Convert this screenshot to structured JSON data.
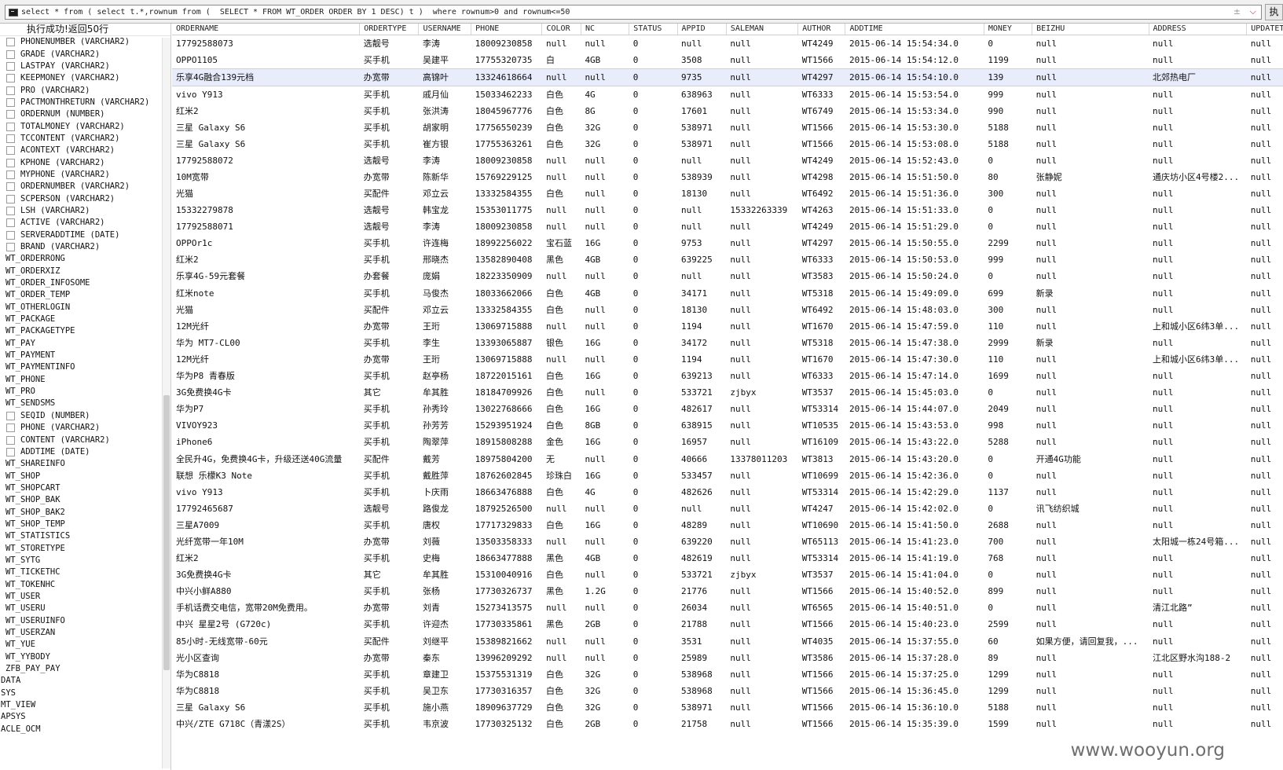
{
  "query": {
    "sql": "select * from ( select t.*,rownum from (  SELECT * FROM WT_ORDER ORDER BY 1 DESC) t )  where rownum>0 and rownum<=50",
    "exec_label": "执"
  },
  "status_text": "执行成功!返回50行",
  "tree": [
    {
      "label": "PHONENUMBER (VARCHAR2)",
      "kind": "col"
    },
    {
      "label": "GRADE (VARCHAR2)",
      "kind": "col"
    },
    {
      "label": "LASTPAY (VARCHAR2)",
      "kind": "col"
    },
    {
      "label": "KEEPMONEY (VARCHAR2)",
      "kind": "col"
    },
    {
      "label": "PRO (VARCHAR2)",
      "kind": "col"
    },
    {
      "label": "PACTMONTHRETURN (VARCHAR2)",
      "kind": "col"
    },
    {
      "label": "ORDERNUM (NUMBER)",
      "kind": "col"
    },
    {
      "label": "TOTALMONEY (VARCHAR2)",
      "kind": "col"
    },
    {
      "label": "TCCONTENT (VARCHAR2)",
      "kind": "col"
    },
    {
      "label": "ACONTEXT (VARCHAR2)",
      "kind": "col"
    },
    {
      "label": "KPHONE (VARCHAR2)",
      "kind": "col"
    },
    {
      "label": "MYPHONE (VARCHAR2)",
      "kind": "col"
    },
    {
      "label": "ORDERNUMBER (VARCHAR2)",
      "kind": "col"
    },
    {
      "label": "SCPERSON (VARCHAR2)",
      "kind": "col"
    },
    {
      "label": "LSH (VARCHAR2)",
      "kind": "col"
    },
    {
      "label": "ACTIVE (VARCHAR2)",
      "kind": "col"
    },
    {
      "label": "SERVERADDTIME (DATE)",
      "kind": "col"
    },
    {
      "label": "BRAND (VARCHAR2)",
      "kind": "col"
    },
    {
      "label": "WT_ORDERRONG",
      "kind": "tbl"
    },
    {
      "label": "WT_ORDERXIZ",
      "kind": "tbl"
    },
    {
      "label": "WT_ORDER_INFOSOME",
      "kind": "tbl"
    },
    {
      "label": "WT_ORDER_TEMP",
      "kind": "tbl"
    },
    {
      "label": "WT_OTHERLOGIN",
      "kind": "tbl"
    },
    {
      "label": "WT_PACKAGE",
      "kind": "tbl"
    },
    {
      "label": "WT_PACKAGETYPE",
      "kind": "tbl"
    },
    {
      "label": "WT_PAY",
      "kind": "tbl"
    },
    {
      "label": "WT_PAYMENT",
      "kind": "tbl"
    },
    {
      "label": "WT_PAYMENTINFO",
      "kind": "tbl"
    },
    {
      "label": "WT_PHONE",
      "kind": "tbl"
    },
    {
      "label": "WT_PRO",
      "kind": "tbl"
    },
    {
      "label": "WT_SENDSMS",
      "kind": "tbl"
    },
    {
      "label": "SEQID (NUMBER)",
      "kind": "col"
    },
    {
      "label": "PHONE (VARCHAR2)",
      "kind": "col"
    },
    {
      "label": "CONTENT (VARCHAR2)",
      "kind": "col"
    },
    {
      "label": "ADDTIME (DATE)",
      "kind": "col"
    },
    {
      "label": "WT_SHAREINFO",
      "kind": "tbl"
    },
    {
      "label": "WT_SHOP",
      "kind": "tbl"
    },
    {
      "label": "WT_SHOPCART",
      "kind": "tbl"
    },
    {
      "label": "WT_SHOP_BAK",
      "kind": "tbl"
    },
    {
      "label": "WT_SHOP_BAK2",
      "kind": "tbl"
    },
    {
      "label": "WT_SHOP_TEMP",
      "kind": "tbl"
    },
    {
      "label": "WT_STATISTICS",
      "kind": "tbl"
    },
    {
      "label": "WT_STORETYPE",
      "kind": "tbl"
    },
    {
      "label": "WT_SYTG",
      "kind": "tbl"
    },
    {
      "label": "WT_TICKETHC",
      "kind": "tbl"
    },
    {
      "label": "WT_TOKENHC",
      "kind": "tbl"
    },
    {
      "label": "WT_USER",
      "kind": "tbl"
    },
    {
      "label": "WT_USERU",
      "kind": "tbl"
    },
    {
      "label": "WT_USERUINFO",
      "kind": "tbl"
    },
    {
      "label": "WT_USERZAN",
      "kind": "tbl"
    },
    {
      "label": "WT_YUE",
      "kind": "tbl"
    },
    {
      "label": "WT_YYBODY",
      "kind": "tbl"
    },
    {
      "label": "ZFB_PAY_PAY",
      "kind": "tbl"
    },
    {
      "label": "DATA",
      "kind": "schema"
    },
    {
      "label": "SYS",
      "kind": "schema"
    },
    {
      "label": "MT_VIEW",
      "kind": "schema"
    },
    {
      "label": "APSYS",
      "kind": "schema"
    },
    {
      "label": "ACLE_OCM",
      "kind": "schema"
    }
  ],
  "columns": [
    "ORDERNAME",
    "ORDERTYPE",
    "USERNAME",
    "PHONE",
    "COLOR",
    "NC",
    "STATUS",
    "APPID",
    "SALEMAN",
    "AUTHOR",
    "ADDTIME",
    "MONEY",
    "BEIZHU",
    "ADDRESS",
    "UPDATET"
  ],
  "selected_row": 2,
  "rows": [
    [
      "17792588073",
      "选靓号",
      "李涛",
      "18009230858",
      "null",
      "null",
      "0",
      "null",
      "null",
      "WT4249",
      "2015-06-14 15:54:34.0",
      "0",
      "null",
      "null",
      "null"
    ],
    [
      "OPPO1105",
      "买手机",
      "吴建平",
      "17755320735",
      "白",
      "4GB",
      "0",
      "3508",
      "null",
      "WT1566",
      "2015-06-14 15:54:12.0",
      "1199",
      "null",
      "null",
      "null"
    ],
    [
      "乐享4G融合139元档",
      "办宽带",
      "高锦叶",
      "13324618664",
      "null",
      "null",
      "0",
      "9735",
      "null",
      "WT4297",
      "2015-06-14 15:54:10.0",
      "139",
      "null",
      "北郊热电厂",
      "null"
    ],
    [
      "vivo Y913",
      "买手机",
      "戚月仙",
      "15033462233",
      "白色",
      "4G",
      "0",
      "638963",
      "null",
      "WT6333",
      "2015-06-14 15:53:54.0",
      "999",
      "null",
      "null",
      "null"
    ],
    [
      "红米2",
      "买手机",
      "张洪涛",
      "18045967776",
      "白色",
      "8G",
      "0",
      "17601",
      "null",
      "WT6749",
      "2015-06-14 15:53:34.0",
      "990",
      "null",
      "null",
      "null"
    ],
    [
      "三星 Galaxy S6",
      "买手机",
      "胡家明",
      "17756550239",
      "白色",
      "32G",
      "0",
      "538971",
      "null",
      "WT1566",
      "2015-06-14 15:53:30.0",
      "5188",
      "null",
      "null",
      "null"
    ],
    [
      "三星 Galaxy S6",
      "买手机",
      "崔方银",
      "17755363261",
      "白色",
      "32G",
      "0",
      "538971",
      "null",
      "WT1566",
      "2015-06-14 15:53:08.0",
      "5188",
      "null",
      "null",
      "null"
    ],
    [
      "17792588072",
      "选靓号",
      "李涛",
      "18009230858",
      "null",
      "null",
      "0",
      "null",
      "null",
      "WT4249",
      "2015-06-14 15:52:43.0",
      "0",
      "null",
      "null",
      "null"
    ],
    [
      "10M宽带",
      "办宽带",
      "陈新华",
      "15769229125",
      "null",
      "null",
      "0",
      "538939",
      "null",
      "WT4298",
      "2015-06-14 15:51:50.0",
      "80",
      "张静妮",
      "通庆坊小区4号楼2...",
      "null"
    ],
    [
      "光猫",
      "买配件",
      "邓立云",
      "13332584355",
      "白色",
      "null",
      "0",
      "18130",
      "null",
      "WT6492",
      "2015-06-14 15:51:36.0",
      "300",
      "null",
      "null",
      "null"
    ],
    [
      "15332279878",
      "选靓号",
      "韩宝龙",
      "15353011775",
      "null",
      "null",
      "0",
      "null",
      "15332263339",
      "WT4263",
      "2015-06-14 15:51:33.0",
      "0",
      "null",
      "null",
      "null"
    ],
    [
      "17792588071",
      "选靓号",
      "李涛",
      "18009230858",
      "null",
      "null",
      "0",
      "null",
      "null",
      "WT4249",
      "2015-06-14 15:51:29.0",
      "0",
      "null",
      "null",
      "null"
    ],
    [
      "OPPOr1c",
      "买手机",
      "许连梅",
      "18992256022",
      "宝石蓝",
      "16G",
      "0",
      "9753",
      "null",
      "WT4297",
      "2015-06-14 15:50:55.0",
      "2299",
      "null",
      "null",
      "null"
    ],
    [
      "红米2",
      "买手机",
      "邢晓杰",
      "13582890408",
      "黑色",
      "4GB",
      "0",
      "639225",
      "null",
      "WT6333",
      "2015-06-14 15:50:53.0",
      "999",
      "null",
      "null",
      "null"
    ],
    [
      "乐享4G-59元套餐",
      "办套餐",
      "庞娟",
      "18223350909",
      "null",
      "null",
      "0",
      "null",
      "null",
      "WT3583",
      "2015-06-14 15:50:24.0",
      "0",
      "null",
      "null",
      "null"
    ],
    [
      "红米note",
      "买手机",
      "马俊杰",
      "18033662066",
      "白色",
      "4GB",
      "0",
      "34171",
      "null",
      "WT5318",
      "2015-06-14 15:49:09.0",
      "699",
      "新录",
      "null",
      "null"
    ],
    [
      "光猫",
      "买配件",
      "邓立云",
      "13332584355",
      "白色",
      "null",
      "0",
      "18130",
      "null",
      "WT6492",
      "2015-06-14 15:48:03.0",
      "300",
      "null",
      "null",
      "null"
    ],
    [
      "12M光纤",
      "办宽带",
      "王珩",
      "13069715888",
      "null",
      "null",
      "0",
      "1194",
      "null",
      "WT1670",
      "2015-06-14 15:47:59.0",
      "110",
      "null",
      "上和城小区6纬3单...",
      "null"
    ],
    [
      "华为 MT7-CL00",
      "买手机",
      "李生",
      "13393065887",
      "银色",
      "16G",
      "0",
      "34172",
      "null",
      "WT5318",
      "2015-06-14 15:47:38.0",
      "2999",
      "新录",
      "null",
      "null"
    ],
    [
      "12M光纤",
      "办宽带",
      "王珩",
      "13069715888",
      "null",
      "null",
      "0",
      "1194",
      "null",
      "WT1670",
      "2015-06-14 15:47:30.0",
      "110",
      "null",
      "上和城小区6纬3单...",
      "null"
    ],
    [
      "华为P8 青春版",
      "买手机",
      "赵亭杨",
      "18722015161",
      "白色",
      "16G",
      "0",
      "639213",
      "null",
      "WT6333",
      "2015-06-14 15:47:14.0",
      "1699",
      "null",
      "null",
      "null"
    ],
    [
      "3G免费换4G卡",
      "其它",
      "牟其胜",
      "18184709926",
      "白色",
      "null",
      "0",
      "533721",
      "zjbyx",
      "WT3537",
      "2015-06-14 15:45:03.0",
      "0",
      "null",
      "null",
      "null"
    ],
    [
      "华为P7",
      "买手机",
      "孙秀玲",
      "13022768666",
      "白色",
      "16G",
      "0",
      "482617",
      "null",
      "WT53314",
      "2015-06-14 15:44:07.0",
      "2049",
      "null",
      "null",
      "null"
    ],
    [
      "VIVOY923",
      "买手机",
      "孙芳芳",
      "15293951924",
      "白色",
      "8GB",
      "0",
      "638915",
      "null",
      "WT10535",
      "2015-06-14 15:43:53.0",
      "998",
      "null",
      "null",
      "null"
    ],
    [
      "iPhone6",
      "买手机",
      "陶翠萍",
      "18915808288",
      "金色",
      "16G",
      "0",
      "16957",
      "null",
      "WT16109",
      "2015-06-14 15:43:22.0",
      "5288",
      "null",
      "null",
      "null"
    ],
    [
      "全民升4G，免费换4G卡，升级还送40G流量",
      "买配件",
      "戴芳",
      "18975804200",
      "无",
      "null",
      "0",
      "40666",
      "13378011203",
      "WT3813",
      "2015-06-14 15:43:20.0",
      "0",
      "开通4G功能",
      "null",
      "null"
    ],
    [
      "联想 乐檬K3 Note",
      "买手机",
      "戴胜萍",
      "18762602845",
      "珍珠白",
      "16G",
      "0",
      "533457",
      "null",
      "WT10699",
      "2015-06-14 15:42:36.0",
      "0",
      "null",
      "null",
      "null"
    ],
    [
      "vivo Y913",
      "买手机",
      "卜庆雨",
      "18663476888",
      "白色",
      "4G",
      "0",
      "482626",
      "null",
      "WT53314",
      "2015-06-14 15:42:29.0",
      "1137",
      "null",
      "null",
      "null"
    ],
    [
      "17792465687",
      "选靓号",
      "路俊龙",
      "18792526500",
      "null",
      "null",
      "0",
      "null",
      "null",
      "WT4247",
      "2015-06-14 15:42:02.0",
      "0",
      "讯飞纺织城",
      "null",
      "null"
    ],
    [
      "三星A7009",
      "买手机",
      "唐权",
      "17717329833",
      "白色",
      "16G",
      "0",
      "48289",
      "null",
      "WT10690",
      "2015-06-14 15:41:50.0",
      "2688",
      "null",
      "null",
      "null"
    ],
    [
      "光纤宽带一年10M",
      "办宽带",
      "刘薇",
      "13503358333",
      "null",
      "null",
      "0",
      "639220",
      "null",
      "WT65113",
      "2015-06-14 15:41:23.0",
      "700",
      "null",
      "太阳城一栋24号箱...",
      "null"
    ],
    [
      "红米2",
      "买手机",
      "史梅",
      "18663477888",
      "黑色",
      "4GB",
      "0",
      "482619",
      "null",
      "WT53314",
      "2015-06-14 15:41:19.0",
      "768",
      "null",
      "null",
      "null"
    ],
    [
      "3G免费换4G卡",
      "其它",
      "牟其胜",
      "15310040916",
      "白色",
      "null",
      "0",
      "533721",
      "zjbyx",
      "WT3537",
      "2015-06-14 15:41:04.0",
      "0",
      "null",
      "null",
      "null"
    ],
    [
      "中兴小鲜A880",
      "买手机",
      "张杨",
      "17730326737",
      "黑色",
      "1.2G",
      "0",
      "21776",
      "null",
      "WT1566",
      "2015-06-14 15:40:52.0",
      "899",
      "null",
      "null",
      "null"
    ],
    [
      "手机话费交电信，宽带20M免费用。",
      "办宽带",
      "刘青",
      "15273413575",
      "null",
      "null",
      "0",
      "26034",
      "null",
      "WT6565",
      "2015-06-14 15:40:51.0",
      "0",
      "null",
      "清江北路”",
      "null"
    ],
    [
      "中兴 星星2号 (G720c)",
      "买手机",
      "许迎杰",
      "17730335861",
      "黑色",
      "2GB",
      "0",
      "21788",
      "null",
      "WT1566",
      "2015-06-14 15:40:23.0",
      "2599",
      "null",
      "null",
      "null"
    ],
    [
      "85小时-无线宽带-60元",
      "买配件",
      "刘继平",
      "15389821662",
      "null",
      "null",
      "0",
      "3531",
      "null",
      "WT4035",
      "2015-06-14 15:37:55.0",
      "60",
      "如果方便，请回复我，...",
      "null",
      "null"
    ],
    [
      " 光小区查询",
      "办宽带",
      "秦东",
      "13996209292",
      "null",
      "null",
      "0",
      "25989",
      "null",
      "WT3586",
      "2015-06-14 15:37:28.0",
      "89",
      "null",
      "江北区野水沟188-2",
      "null"
    ],
    [
      "华为C8818",
      "买手机",
      "章建卫",
      "15375531319",
      "白色",
      "32G",
      "0",
      "538968",
      "null",
      "WT1566",
      "2015-06-14 15:37:25.0",
      "1299",
      "null",
      "null",
      "null"
    ],
    [
      "华为C8818",
      "买手机",
      "吴卫东",
      "17730316357",
      "白色",
      "32G",
      "0",
      "538968",
      "null",
      "WT1566",
      "2015-06-14 15:36:45.0",
      "1299",
      "null",
      "null",
      "null"
    ],
    [
      "三星 Galaxy S6",
      "买手机",
      "施小燕",
      "18909637729",
      "白色",
      "32G",
      "0",
      "538971",
      "null",
      "WT1566",
      "2015-06-14 15:36:10.0",
      "5188",
      "null",
      "null",
      "null"
    ],
    [
      "中兴/ZTE G718C（青漾2S）",
      "买手机",
      "韦京波",
      "17730325132",
      "白色",
      "2GB",
      "0",
      "21758",
      "null",
      "WT1566",
      "2015-06-14 15:35:39.0",
      "1599",
      "null",
      "null",
      "null"
    ]
  ],
  "watermark": "www.wooyun.org"
}
